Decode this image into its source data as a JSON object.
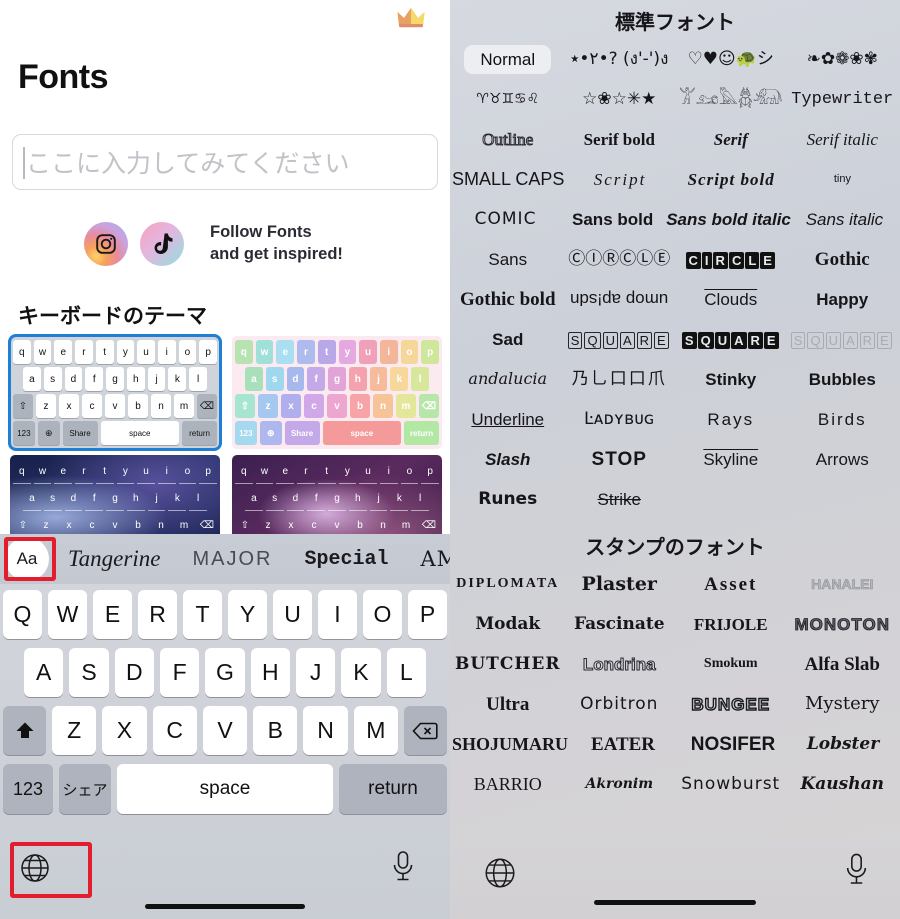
{
  "left": {
    "crown_icon": "crown-emoji",
    "title": "Fonts",
    "input": {
      "placeholder": "ここに入力してみてください",
      "value": ""
    },
    "social": {
      "instagram_icon": "instagram-icon",
      "tiktok_icon": "tiktok-icon",
      "line1": "Follow Fonts",
      "line2": "and get inspired!"
    },
    "themes_heading": "キーボードのテーマ",
    "theme_keys": {
      "row1": [
        "q",
        "w",
        "e",
        "r",
        "t",
        "y",
        "u",
        "i",
        "o",
        "p"
      ],
      "row2": [
        "a",
        "s",
        "d",
        "f",
        "g",
        "h",
        "j",
        "k",
        "l"
      ],
      "row3": [
        "⇧",
        "z",
        "x",
        "c",
        "v",
        "b",
        "n",
        "m",
        "⌫"
      ],
      "row4": [
        "123",
        "🌐",
        "Share",
        "space",
        "return"
      ]
    },
    "themes": [
      {
        "name": "light",
        "selected": true
      },
      {
        "name": "pastel",
        "selected": false
      },
      {
        "name": "galaxy-blue",
        "selected": false
      },
      {
        "name": "galaxy-purple",
        "selected": false
      }
    ],
    "font_strip": {
      "aa_label": "Aa",
      "items": [
        "Tangerine",
        "MAJOR",
        "Special",
        "AMATI"
      ]
    },
    "keyboard": {
      "row1": [
        "Q",
        "W",
        "E",
        "R",
        "T",
        "Y",
        "U",
        "I",
        "O",
        "P"
      ],
      "row2": [
        "A",
        "S",
        "D",
        "F",
        "G",
        "H",
        "J",
        "K",
        "L"
      ],
      "row3_shift_icon": "shift-icon",
      "row3": [
        "Z",
        "X",
        "C",
        "V",
        "B",
        "N",
        "M"
      ],
      "row3_backspace_icon": "backspace-icon",
      "num_label": "123",
      "share_label": "シェア",
      "space_label": "space",
      "return_label": "return",
      "globe_icon": "globe-icon",
      "mic_icon": "microphone-icon"
    }
  },
  "right": {
    "heading_standard": "標準フォント",
    "heading_stamp": "スタンプのフォント",
    "selected_font": "Normal",
    "standard_rows": [
      [
        {
          "t": "Normal",
          "s": "pill"
        },
        {
          "t": "٢•٭•? (ง'-')ง",
          "s": "sym"
        },
        {
          "t": "♡♥☺🐢シ",
          "s": "sym"
        },
        {
          "t": "❧✿❁❀✾",
          "s": "sym"
        }
      ],
      [
        {
          "t": "♈♉♊♋♌",
          "s": "sym"
        },
        {
          "t": "☆❀☆✳★",
          "s": "sym"
        },
        {
          "t": "𓀠𓃭𓅓𓆣𓃰",
          "s": "sym"
        },
        {
          "t": "Typewriter",
          "s": "mono"
        }
      ],
      [
        {
          "t": "Outline",
          "s": "outline"
        },
        {
          "t": "Serif bold",
          "s": "serif-bold"
        },
        {
          "t": "Serif",
          "s": "serif-bold-italic"
        },
        {
          "t": "Serif italic",
          "s": "serif-italic"
        }
      ],
      [
        {
          "t": "SMALL CAPS",
          "s": "smallcaps"
        },
        {
          "t": "Script",
          "s": "script"
        },
        {
          "t": "Script bold",
          "s": "script-bold"
        },
        {
          "t": "tiny",
          "s": "tiny"
        }
      ],
      [
        {
          "t": "COMIC",
          "s": "comic"
        },
        {
          "t": "Sans bold",
          "s": "bold"
        },
        {
          "t": "Sans bold italic",
          "s": "bold-italic"
        },
        {
          "t": "Sans italic",
          "s": "italic"
        }
      ],
      [
        {
          "t": "Sans",
          "s": "plain"
        },
        {
          "t": "ⒸⒾⓇⒸⓁⒺ",
          "s": "sym"
        },
        {
          "t": "🅒🅘🅡🅒🅛🅔",
          "s": "invert"
        },
        {
          "t": "Gothic",
          "s": "gothic"
        }
      ],
      [
        {
          "t": "Gothic bold",
          "s": "gothic-bold"
        },
        {
          "t": "umop ap!sdn",
          "s": "upside-down"
        },
        {
          "t": "Clouds",
          "s": "clouds"
        },
        {
          "t": "Happy",
          "s": "happy"
        }
      ],
      [
        {
          "t": "Sad",
          "s": "sad"
        },
        {
          "t": "SQUARE",
          "s": "boxed"
        },
        {
          "t": "SQUARE",
          "s": "invert-box"
        },
        {
          "t": "SQUARE",
          "s": "faint-box"
        }
      ],
      [
        {
          "t": "andalucia",
          "s": "andalucia"
        },
        {
          "t": "乃乚口口爪",
          "s": "sym"
        },
        {
          "t": "Stinky",
          "s": "stinky"
        },
        {
          "t": "Bubbles",
          "s": "bubbles"
        }
      ],
      [
        {
          "t": "Underline",
          "s": "underline"
        },
        {
          "t": "Ŀᴀᴅʏʙᴜɢ",
          "s": "ladybug"
        },
        {
          "t": "Rays",
          "s": "rays"
        },
        {
          "t": "Birds",
          "s": "birds"
        }
      ],
      [
        {
          "t": "Slash",
          "s": "slash"
        },
        {
          "t": "STOP",
          "s": "stop"
        },
        {
          "t": "Skyline",
          "s": "skyline"
        },
        {
          "t": "Arrows",
          "s": "arrows"
        }
      ],
      [
        {
          "t": "Runes",
          "s": "runes"
        },
        {
          "t": "Strike",
          "s": "strike"
        },
        {
          "t": "",
          "s": "plain"
        },
        {
          "t": "",
          "s": "plain"
        }
      ]
    ],
    "stamp_rows": [
      [
        {
          "t": "DIPLOMATA",
          "s": "diplomata"
        },
        {
          "t": "Plaster",
          "s": "plaster"
        },
        {
          "t": "Asset",
          "s": "asset"
        },
        {
          "t": "HANALEI",
          "s": "hanalei"
        }
      ],
      [
        {
          "t": "Modak",
          "s": "modak"
        },
        {
          "t": "Fascinate",
          "s": "fascinate"
        },
        {
          "t": "FRIJOLE",
          "s": "frijole"
        },
        {
          "t": "MONOTON",
          "s": "monoton"
        }
      ],
      [
        {
          "t": "BUTCHER",
          "s": "butcher"
        },
        {
          "t": "Londrina",
          "s": "londrina"
        },
        {
          "t": "Smokum",
          "s": "smokum"
        },
        {
          "t": "Alfa Slab",
          "s": "alfaslab"
        }
      ],
      [
        {
          "t": "Ultra",
          "s": "ultra"
        },
        {
          "t": "Orbitron",
          "s": "orbitron"
        },
        {
          "t": "BUNGEE",
          "s": "bungee"
        },
        {
          "t": "Mystery",
          "s": "mystery"
        }
      ],
      [
        {
          "t": "SHOJUMARU",
          "s": "shojumaru"
        },
        {
          "t": "EATER",
          "s": "eater"
        },
        {
          "t": "NOSIFER",
          "s": "nosifer"
        },
        {
          "t": "Lobster",
          "s": "lobster"
        }
      ],
      [
        {
          "t": "BARRIO",
          "s": "barrio"
        },
        {
          "t": "Akronim",
          "s": "akronim"
        },
        {
          "t": "Snowburst",
          "s": "snowburst"
        },
        {
          "t": "Kaushan",
          "s": "kaushan"
        }
      ]
    ],
    "globe_icon": "globe-icon",
    "mic_icon": "microphone-icon"
  },
  "annotations": {
    "highlight_color": "#e11d2e",
    "highlight_boxes": [
      "aa-font-button",
      "globe-key",
      "globe-key-right"
    ]
  }
}
